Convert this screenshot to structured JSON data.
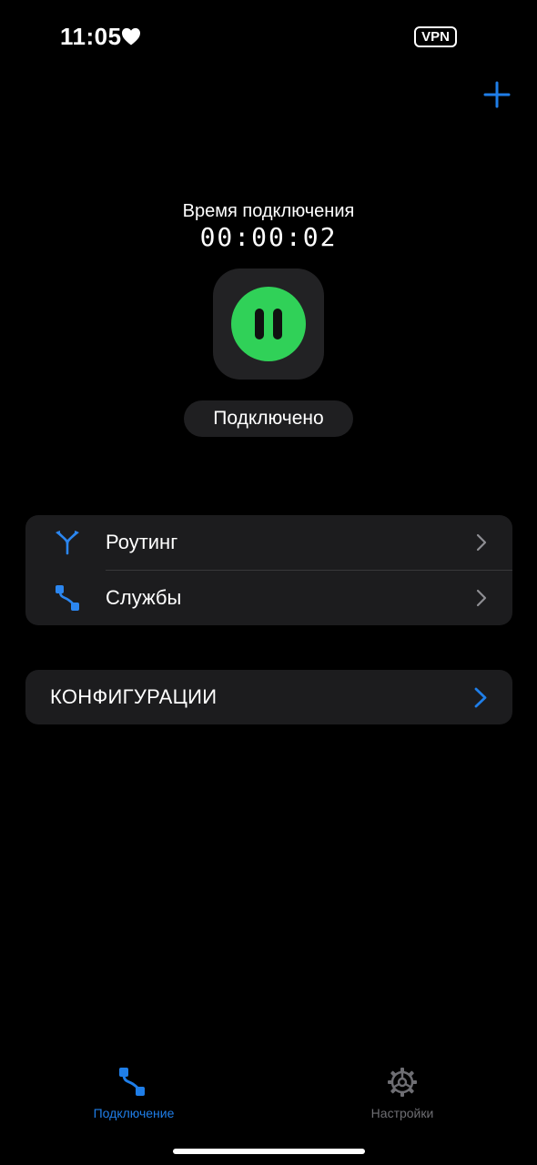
{
  "status_bar": {
    "time": "11:05",
    "heart_icon": "heart-icon",
    "vpn_label": "VPN"
  },
  "header": {
    "add_icon": "plus-icon",
    "accent_color": "#1f7ee8"
  },
  "connection": {
    "timer_label": "Время подключения",
    "timer_value": "00:00:02",
    "toggle_icon": "pause-icon",
    "toggle_color": "#30d158",
    "status_text": "Подключено"
  },
  "menu": {
    "items": [
      {
        "label": "Роутинг",
        "icon": "routing-icon"
      },
      {
        "label": "Службы",
        "icon": "services-icon"
      }
    ]
  },
  "configurations": {
    "label": "КОНФИГУРАЦИИ"
  },
  "tab_bar": {
    "tabs": [
      {
        "label": "Подключение",
        "icon": "connection-icon",
        "active": true,
        "color": "#1f7ee8"
      },
      {
        "label": "Настройки",
        "icon": "gear-icon",
        "active": false,
        "color": "#6e6e73"
      }
    ]
  }
}
